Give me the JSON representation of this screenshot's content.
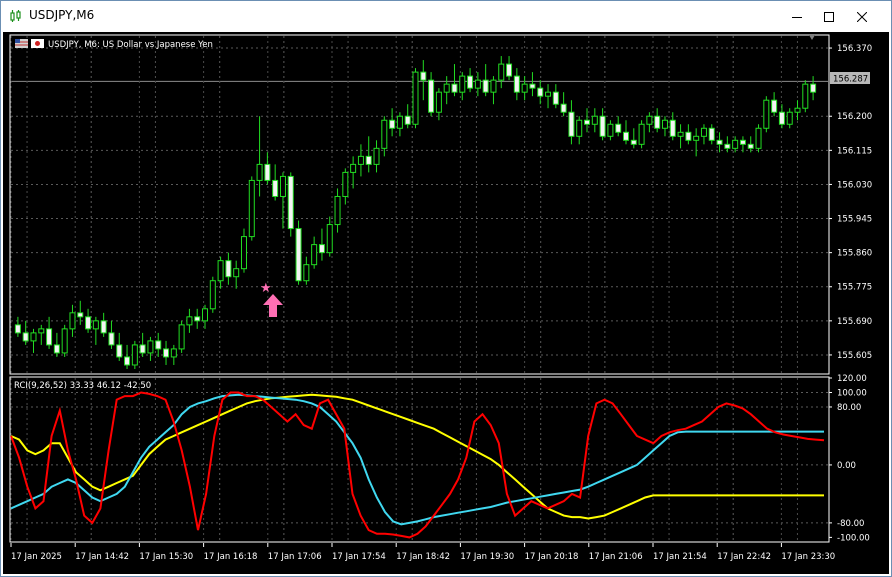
{
  "window": {
    "title": "USDJPY,M6"
  },
  "main_chart": {
    "symbol_label": "USDJPY, M6:  US Dollar vs Japanese Yen",
    "current_price": "156.287",
    "price_ticks": [
      "156.370",
      "156.287",
      "156.200",
      "156.115",
      "156.030",
      "155.945",
      "155.860",
      "155.775",
      "155.690",
      "155.605"
    ],
    "time_labels": [
      "17 Jan 2025",
      "17 Jan 14:42",
      "17 Jan 15:30",
      "17 Jan 16:18",
      "17 Jan 17:06",
      "17 Jan 17:54",
      "17 Jan 18:42",
      "17 Jan 19:30",
      "17 Jan 20:18",
      "17 Jan 21:06",
      "17 Jan 21:54",
      "17 Jan 22:42",
      "17 Jan 23:30"
    ],
    "signal_marker": {
      "type": "buy-arrow",
      "price": 155.74
    }
  },
  "indicator": {
    "label": "RCI(9,26,52) 33.33 46.12 -42.50",
    "ticks": [
      "120.00",
      "100.00",
      "80.00",
      "0.00",
      "-80.00",
      "-100.00"
    ],
    "colors": {
      "short": "#ff0000",
      "mid": "#40d8f0",
      "long": "#ffff00"
    }
  },
  "chart_data": {
    "type": "candlestick",
    "symbol": "USDJPY",
    "timeframe": "M6",
    "ylim": [
      155.56,
      156.4
    ],
    "candles": [
      [
        155.68,
        155.7,
        155.65,
        155.66
      ],
      [
        155.66,
        155.69,
        155.63,
        155.64
      ],
      [
        155.64,
        155.67,
        155.61,
        155.66
      ],
      [
        155.66,
        155.68,
        155.63,
        155.67
      ],
      [
        155.67,
        155.7,
        155.62,
        155.63
      ],
      [
        155.63,
        155.66,
        155.6,
        155.61
      ],
      [
        155.61,
        155.68,
        155.6,
        155.67
      ],
      [
        155.67,
        155.73,
        155.65,
        155.71
      ],
      [
        155.71,
        155.74,
        155.68,
        155.7
      ],
      [
        155.7,
        155.72,
        155.66,
        155.67
      ],
      [
        155.67,
        155.7,
        155.63,
        155.69
      ],
      [
        155.69,
        155.71,
        155.65,
        155.66
      ],
      [
        155.66,
        155.69,
        155.62,
        155.63
      ],
      [
        155.63,
        155.66,
        155.59,
        155.6
      ],
      [
        155.6,
        155.63,
        155.57,
        155.58
      ],
      [
        155.58,
        155.64,
        155.57,
        155.63
      ],
      [
        155.63,
        155.66,
        155.6,
        155.61
      ],
      [
        155.61,
        155.65,
        155.59,
        155.64
      ],
      [
        155.64,
        155.66,
        155.6,
        155.62
      ],
      [
        155.62,
        155.64,
        155.58,
        155.6
      ],
      [
        155.6,
        155.63,
        155.58,
        155.62
      ],
      [
        155.62,
        155.69,
        155.61,
        155.68
      ],
      [
        155.68,
        155.72,
        155.66,
        155.7
      ],
      [
        155.7,
        155.72,
        155.67,
        155.69
      ],
      [
        155.69,
        155.73,
        155.67,
        155.72
      ],
      [
        155.72,
        155.8,
        155.71,
        155.79
      ],
      [
        155.79,
        155.85,
        155.77,
        155.84
      ],
      [
        155.84,
        155.86,
        155.78,
        155.8
      ],
      [
        155.8,
        155.84,
        155.77,
        155.82
      ],
      [
        155.82,
        155.92,
        155.81,
        155.9
      ],
      [
        155.9,
        156.05,
        155.89,
        156.04
      ],
      [
        156.04,
        156.2,
        156.0,
        156.08
      ],
      [
        156.08,
        156.11,
        156.03,
        156.04
      ],
      [
        156.04,
        156.08,
        155.99,
        156.0
      ],
      [
        156.0,
        156.06,
        155.92,
        156.05
      ],
      [
        156.05,
        156.06,
        155.9,
        155.92
      ],
      [
        155.92,
        155.94,
        155.78,
        155.79
      ],
      [
        155.79,
        155.85,
        155.78,
        155.83
      ],
      [
        155.83,
        155.9,
        155.82,
        155.88
      ],
      [
        155.88,
        155.92,
        155.84,
        155.86
      ],
      [
        155.86,
        155.95,
        155.85,
        155.93
      ],
      [
        155.93,
        156.02,
        155.91,
        156.0
      ],
      [
        156.0,
        156.07,
        155.98,
        156.06
      ],
      [
        156.06,
        156.1,
        156.02,
        156.08
      ],
      [
        156.08,
        156.13,
        156.05,
        156.1
      ],
      [
        156.1,
        156.15,
        156.06,
        156.08
      ],
      [
        156.08,
        156.14,
        156.06,
        156.12
      ],
      [
        156.12,
        156.2,
        156.1,
        156.19
      ],
      [
        156.19,
        156.22,
        156.15,
        156.17
      ],
      [
        156.17,
        156.21,
        156.15,
        156.2
      ],
      [
        156.2,
        156.23,
        156.17,
        156.18
      ],
      [
        156.18,
        156.32,
        156.17,
        156.31
      ],
      [
        156.31,
        156.34,
        156.24,
        156.29
      ],
      [
        156.29,
        156.31,
        156.2,
        156.21
      ],
      [
        156.21,
        156.27,
        156.19,
        156.26
      ],
      [
        156.26,
        156.3,
        156.23,
        156.28
      ],
      [
        156.28,
        156.33,
        156.25,
        156.26
      ],
      [
        156.26,
        156.31,
        156.24,
        156.3
      ],
      [
        156.3,
        156.32,
        156.26,
        156.27
      ],
      [
        156.27,
        156.31,
        156.25,
        156.29
      ],
      [
        156.29,
        156.33,
        156.25,
        156.26
      ],
      [
        156.26,
        156.3,
        156.23,
        156.29
      ],
      [
        156.29,
        156.35,
        156.27,
        156.33
      ],
      [
        156.33,
        156.35,
        156.29,
        156.3
      ],
      [
        156.3,
        156.32,
        156.24,
        156.26
      ],
      [
        156.26,
        156.3,
        156.24,
        156.28
      ],
      [
        156.28,
        156.31,
        156.25,
        156.27
      ],
      [
        156.27,
        156.29,
        156.23,
        156.25
      ],
      [
        156.25,
        156.28,
        156.22,
        156.26
      ],
      [
        156.26,
        156.28,
        156.22,
        156.23
      ],
      [
        156.23,
        156.26,
        156.2,
        156.21
      ],
      [
        156.21,
        156.24,
        156.13,
        156.15
      ],
      [
        156.15,
        156.2,
        156.13,
        156.19
      ],
      [
        156.19,
        156.22,
        156.16,
        156.18
      ],
      [
        156.18,
        156.22,
        156.16,
        156.2
      ],
      [
        156.2,
        156.22,
        156.14,
        156.15
      ],
      [
        156.15,
        156.19,
        156.14,
        156.18
      ],
      [
        156.18,
        156.2,
        156.15,
        156.16
      ],
      [
        156.16,
        156.19,
        156.13,
        156.14
      ],
      [
        156.14,
        156.17,
        156.12,
        156.13
      ],
      [
        156.13,
        156.19,
        156.12,
        156.18
      ],
      [
        156.18,
        156.21,
        156.16,
        156.2
      ],
      [
        156.2,
        156.22,
        156.16,
        156.17
      ],
      [
        156.17,
        156.2,
        156.15,
        156.19
      ],
      [
        156.19,
        156.21,
        156.14,
        156.15
      ],
      [
        156.15,
        156.18,
        156.12,
        156.16
      ],
      [
        156.16,
        156.18,
        156.13,
        156.14
      ],
      [
        156.14,
        156.17,
        156.1,
        156.15
      ],
      [
        156.15,
        156.18,
        156.13,
        156.17
      ],
      [
        156.17,
        156.18,
        156.13,
        156.14
      ],
      [
        156.14,
        156.16,
        156.11,
        156.13
      ],
      [
        156.13,
        156.15,
        156.11,
        156.12
      ],
      [
        156.12,
        156.15,
        156.11,
        156.14
      ],
      [
        156.14,
        156.15,
        156.11,
        156.13
      ],
      [
        156.13,
        156.15,
        156.11,
        156.12
      ],
      [
        156.12,
        156.18,
        156.11,
        156.17
      ],
      [
        156.17,
        156.25,
        156.16,
        156.24
      ],
      [
        156.24,
        156.26,
        156.2,
        156.21
      ],
      [
        156.21,
        156.23,
        156.17,
        156.18
      ],
      [
        156.18,
        156.22,
        156.17,
        156.21
      ],
      [
        156.21,
        156.24,
        156.19,
        156.22
      ],
      [
        156.22,
        156.29,
        156.21,
        156.28
      ],
      [
        156.28,
        156.3,
        156.24,
        156.26
      ]
    ],
    "indicator_ylim": [
      -105,
      120
    ]
  }
}
